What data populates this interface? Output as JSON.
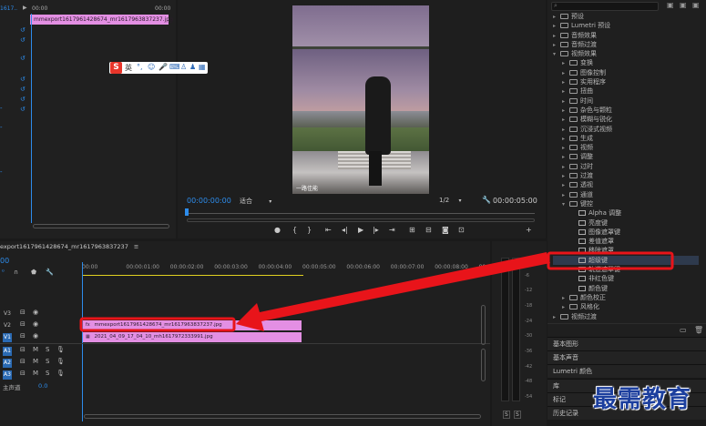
{
  "source_panel": {
    "timecode_label": "tc 0",
    "header_time": "00:00",
    "header_end": "00:00",
    "clip_label": "mmexport1617961428674_mr1617963837237.jpg"
  },
  "program": {
    "timecode": "00:00:00:00",
    "fit_option": "适合",
    "resolution": "1/2",
    "duration": "00:00:05:00",
    "watermark": "一路佳能"
  },
  "ime_toolbar": {
    "logo": "S",
    "lang": "英"
  },
  "effects": {
    "items": [
      {
        "label": "预设",
        "type": "folder",
        "open": false,
        "indent": 0
      },
      {
        "label": "Lumetri 预设",
        "type": "folder",
        "open": false,
        "indent": 0
      },
      {
        "label": "音频效果",
        "type": "folder",
        "open": false,
        "indent": 0
      },
      {
        "label": "音频过渡",
        "type": "folder",
        "open": false,
        "indent": 0
      },
      {
        "label": "视频效果",
        "type": "folder",
        "open": true,
        "indent": 0
      },
      {
        "label": "变换",
        "type": "folder",
        "open": false,
        "indent": 1
      },
      {
        "label": "图像控制",
        "type": "folder",
        "open": false,
        "indent": 1
      },
      {
        "label": "实用程序",
        "type": "folder",
        "open": false,
        "indent": 1
      },
      {
        "label": "扭曲",
        "type": "folder",
        "open": false,
        "indent": 1
      },
      {
        "label": "时间",
        "type": "folder",
        "open": false,
        "indent": 1
      },
      {
        "label": "杂色与颗粒",
        "type": "folder",
        "open": false,
        "indent": 1
      },
      {
        "label": "模糊与锐化",
        "type": "folder",
        "open": false,
        "indent": 1
      },
      {
        "label": "沉浸式视频",
        "type": "folder",
        "open": false,
        "indent": 1
      },
      {
        "label": "生成",
        "type": "folder",
        "open": false,
        "indent": 1
      },
      {
        "label": "视频",
        "type": "folder",
        "open": false,
        "indent": 1
      },
      {
        "label": "调整",
        "type": "folder",
        "open": false,
        "indent": 1
      },
      {
        "label": "过时",
        "type": "folder",
        "open": false,
        "indent": 1
      },
      {
        "label": "过渡",
        "type": "folder",
        "open": false,
        "indent": 1
      },
      {
        "label": "透视",
        "type": "folder",
        "open": false,
        "indent": 1
      },
      {
        "label": "通道",
        "type": "folder",
        "open": false,
        "indent": 1
      },
      {
        "label": "键控",
        "type": "folder",
        "open": true,
        "indent": 1
      },
      {
        "label": "Alpha 调整",
        "type": "effect",
        "indent": 2
      },
      {
        "label": "亮度键",
        "type": "effect",
        "indent": 2
      },
      {
        "label": "图像遮罩键",
        "type": "effect",
        "indent": 2
      },
      {
        "label": "差值遮罩",
        "type": "effect",
        "indent": 2
      },
      {
        "label": "移除遮罩",
        "type": "effect",
        "indent": 2
      },
      {
        "label": "超级键",
        "type": "effect",
        "indent": 2,
        "highlighted": true
      },
      {
        "label": "轨道遮罩键",
        "type": "effect",
        "indent": 2
      },
      {
        "label": "非红色键",
        "type": "effect",
        "indent": 2
      },
      {
        "label": "颜色键",
        "type": "effect",
        "indent": 2
      },
      {
        "label": "颜色校正",
        "type": "folder",
        "open": false,
        "indent": 1
      },
      {
        "label": "风格化",
        "type": "folder",
        "open": false,
        "indent": 1
      },
      {
        "label": "视频过渡",
        "type": "folder",
        "open": false,
        "indent": 0
      }
    ]
  },
  "right_sections": [
    "基本图形",
    "基本声音",
    "Lumetri 颜色",
    "库",
    "标记",
    "历史记录"
  ],
  "timeline": {
    "tab": "export1617961428674_mr1617963837237",
    "timecode": "00",
    "ruler": [
      "00:00",
      "00:00:01:00",
      "00:00:02:00",
      "00:00:03:00",
      "00:00:04:00",
      "00:00:05:00",
      "00:00:06:00",
      "00:00:07:00",
      "00:00:08:00",
      "00:00:09:00"
    ],
    "tracks": [
      {
        "name": "V3",
        "type": "video",
        "on": false
      },
      {
        "name": "V2",
        "type": "video",
        "on": false
      },
      {
        "name": "V1",
        "type": "video",
        "on": true
      },
      {
        "name": "A1",
        "type": "audio",
        "on": true
      },
      {
        "name": "A2",
        "type": "audio",
        "on": true
      },
      {
        "name": "A3",
        "type": "audio",
        "on": true
      }
    ],
    "master_label": "主声道",
    "master_value": "0.0",
    "clips": {
      "v2": "mmexport1617961428674_mr1617963837237.jpg",
      "v1": "2021_04_09_17_04_10_mh1617972333991.jpg"
    }
  },
  "meter_scale": [
    "0",
    "-6",
    "-12",
    "-18",
    "-24",
    "-30",
    "-36",
    "-42",
    "-48",
    "-54"
  ],
  "meter_buttons": [
    "S",
    "S"
  ],
  "brand": "最需教育",
  "colors": {
    "accent": "#2d8ceb",
    "clip_pink": "#e38fe3",
    "highlight_red": "#e8141a",
    "brand": "#1c3f9e"
  }
}
